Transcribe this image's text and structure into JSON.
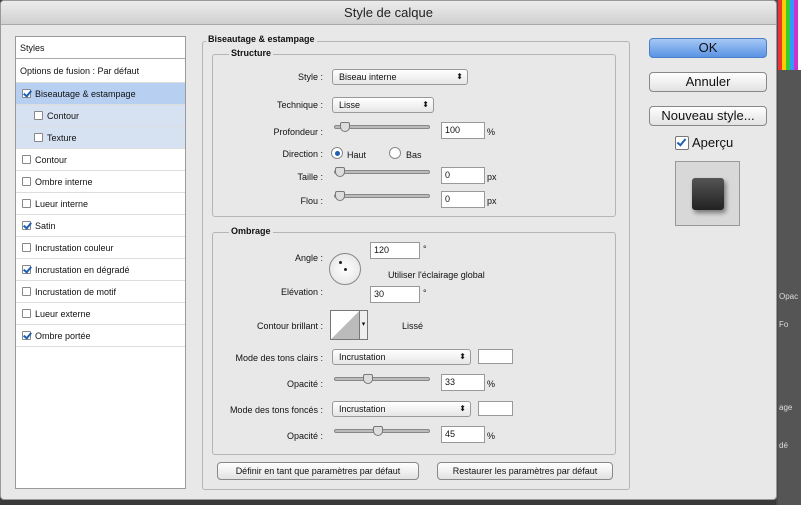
{
  "window": {
    "title": "Style de calque"
  },
  "styles_panel": {
    "header": "Styles",
    "blend": "Options de fusion : Par défaut",
    "items": [
      {
        "label": "Biseautage & estampage",
        "checked": true
      },
      {
        "label": "Contour",
        "checked": false
      },
      {
        "label": "Texture",
        "checked": false
      },
      {
        "label": "Contour",
        "checked": false
      },
      {
        "label": "Ombre interne",
        "checked": false
      },
      {
        "label": "Lueur interne",
        "checked": false
      },
      {
        "label": "Satin",
        "checked": true
      },
      {
        "label": "Incrustation couleur",
        "checked": false
      },
      {
        "label": "Incrustation en dégradé",
        "checked": true
      },
      {
        "label": "Incrustation de motif",
        "checked": false
      },
      {
        "label": "Lueur externe",
        "checked": false
      },
      {
        "label": "Ombre portée",
        "checked": true
      }
    ]
  },
  "bevel": {
    "title": "Biseautage & estampage",
    "structure": {
      "title": "Structure",
      "style_label": "Style :",
      "style_value": "Biseau interne",
      "technique_label": "Technique :",
      "technique_value": "Lisse",
      "depth_label": "Profondeur :",
      "depth_value": "100",
      "depth_unit": "%",
      "depth_level": 0.06,
      "direction_label": "Direction :",
      "dir_up": "Haut",
      "dir_down": "Bas",
      "size_label": "Taille :",
      "size_value": "0",
      "size_unit": "px",
      "size_level": 0.0,
      "soften_label": "Flou :",
      "soften_value": "0",
      "soften_unit": "px",
      "soften_level": 0.0
    },
    "shading": {
      "title": "Ombrage",
      "angle_label": "Angle :",
      "angle_value": "120",
      "angle_unit": "°",
      "global_light": "Utiliser l'éclairage global",
      "altitude_label": "Elévation :",
      "altitude_value": "30",
      "altitude_unit": "°",
      "gloss_label": "Contour brillant :",
      "antialias": "Lissé",
      "highlight_label": "Mode des tons clairs :",
      "highlight_mode": "Incrustation",
      "highlight_opacity_label": "Opacité :",
      "highlight_opacity": "33",
      "highlight_opacity_unit": "%",
      "highlight_level": 0.33,
      "shadow_label": "Mode des tons foncés :",
      "shadow_mode": "Incrustation",
      "shadow_opacity_label": "Opacité :",
      "shadow_opacity": "45",
      "shadow_opacity_unit": "%",
      "shadow_level": 0.45
    },
    "make_default": "Définir en tant que paramètres par défaut",
    "reset_default": "Restaurer les paramètres par défaut"
  },
  "buttons": {
    "ok": "OK",
    "cancel": "Annuler",
    "new_style": "Nouveau style...",
    "preview": "Aperçu"
  },
  "side": {
    "l1": "Opac",
    "l2": "Fo",
    "l3": "age",
    "l4": "dé"
  }
}
